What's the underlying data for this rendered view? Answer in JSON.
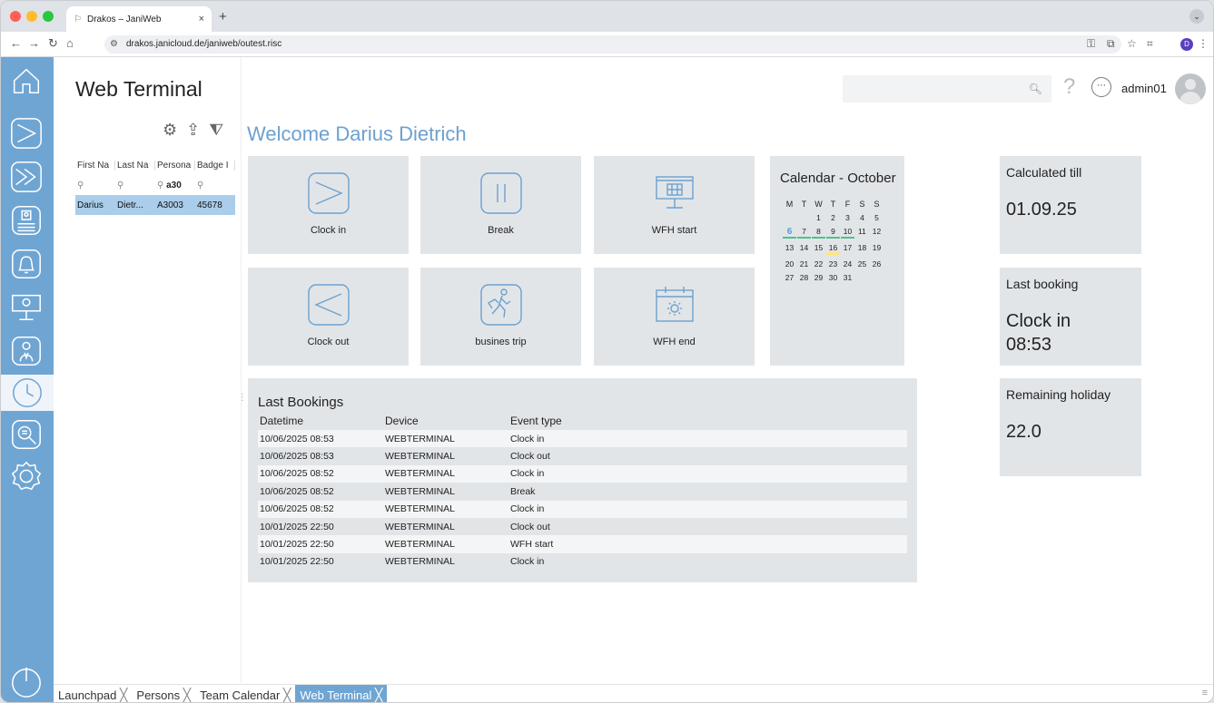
{
  "browser": {
    "tab_title": "Drakos – JaniWeb",
    "tab_close": "×",
    "new_tab": "+",
    "url": "drakos.janicloud.de/janiweb/outest.risc",
    "profile_initial": "D"
  },
  "header": {
    "title": "Web Terminal",
    "search_placeholder": "",
    "help": "?",
    "username": "admin01"
  },
  "person_table": {
    "columns": [
      "First Na",
      "Last Na",
      "Persona",
      "Badge I"
    ],
    "filters": [
      "",
      "",
      "a30",
      ""
    ],
    "rows": [
      [
        "Darius",
        "Dietr...",
        "A3003",
        "45678"
      ]
    ]
  },
  "welcome": "Welcome Darius Dietrich",
  "tiles": [
    {
      "label": "Clock in",
      "icon": "clock-in-icon"
    },
    {
      "label": "Break",
      "icon": "break-icon"
    },
    {
      "label": "WFH start",
      "icon": "wfh-start-icon"
    },
    {
      "label": "Clock out",
      "icon": "clock-out-icon"
    },
    {
      "label": "busines trip",
      "icon": "business-trip-icon"
    },
    {
      "label": "WFH end",
      "icon": "wfh-end-icon"
    }
  ],
  "calendar": {
    "title": "Calendar - October",
    "day_headers": [
      "M",
      "T",
      "W",
      "T",
      "F",
      "S",
      "S"
    ],
    "days": [
      "",
      "",
      "1",
      "2",
      "3",
      "4",
      "5",
      "6",
      "7",
      "8",
      "9",
      "10",
      "11",
      "12",
      "13",
      "14",
      "15",
      "16",
      "17",
      "18",
      "19",
      "20",
      "21",
      "22",
      "23",
      "24",
      "25",
      "26",
      "27",
      "28",
      "29",
      "30",
      "31"
    ],
    "today": "6",
    "green_marked": [
      "6",
      "7",
      "8",
      "9",
      "10"
    ],
    "yellow_marked": [
      "16"
    ],
    "colors": {
      "today": "#5a9bd4",
      "booked": "#4fc08d",
      "holiday": "#ffe680"
    }
  },
  "info_cards": {
    "calculated": {
      "label": "Calculated till",
      "value": "01.09.25"
    },
    "last_booking": {
      "label": "Last booking",
      "value_line1": "Clock in",
      "value_line2": "08:53"
    },
    "holiday": {
      "label": "Remaining holiday",
      "value": "22.0"
    }
  },
  "last_bookings": {
    "title": "Last Bookings",
    "columns": [
      "Datetime",
      "Device",
      "Event type"
    ],
    "rows": [
      [
        "10/06/2025 08:53",
        "WEBTERMINAL",
        "Clock in"
      ],
      [
        "10/06/2025 08:53",
        "WEBTERMINAL",
        "Clock out"
      ],
      [
        "10/06/2025 08:52",
        "WEBTERMINAL",
        "Clock in"
      ],
      [
        "10/06/2025 08:52",
        "WEBTERMINAL",
        "Break"
      ],
      [
        "10/06/2025 08:52",
        "WEBTERMINAL",
        "Clock in"
      ],
      [
        "10/01/2025 22:50",
        "WEBTERMINAL",
        "Clock out"
      ],
      [
        "10/01/2025 22:50",
        "WEBTERMINAL",
        "WFH start"
      ],
      [
        "10/01/2025 22:50",
        "WEBTERMINAL",
        "Clock in"
      ]
    ]
  },
  "bottom_tabs": [
    {
      "label": "Launchpad",
      "active": false
    },
    {
      "label": "Persons",
      "active": false
    },
    {
      "label": "Team Calendar",
      "active": false
    },
    {
      "label": "Web Terminal",
      "active": true
    }
  ],
  "close_glyph": "╳",
  "colors": {
    "accent": "#6fa5d3",
    "title_blue": "#6ca1cf",
    "tile_bg": "#e2e5e8",
    "selected_row": "#a9cdea"
  }
}
